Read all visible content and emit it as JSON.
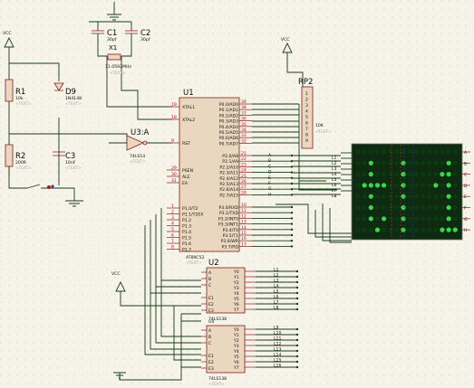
{
  "power": {
    "vcc": "VCC"
  },
  "components": {
    "c1": {
      "ref": "C1",
      "value": "30pf"
    },
    "c2": {
      "ref": "C2",
      "value": "30pf"
    },
    "x1": {
      "ref": "X1",
      "value": "11.0592MHz"
    },
    "r1": {
      "ref": "R1",
      "value": "10k"
    },
    "d9": {
      "ref": "D9",
      "value": "1N4148"
    },
    "r2": {
      "ref": "R2",
      "value": "200R"
    },
    "c3": {
      "ref": "C3",
      "value": "10nF"
    },
    "u3": {
      "ref": "U3:A",
      "value": "74LS14"
    },
    "u1": {
      "ref": "U1",
      "value": "AT89C52"
    },
    "u2": {
      "ref": "U2",
      "value": "74LS138"
    },
    "u4": {
      "ref": "U4",
      "value": "74LS138"
    },
    "rp2": {
      "ref": "RP2",
      "value": "10K"
    },
    "text_tag": "<TEXT>"
  },
  "u1_pins": {
    "left_top": [
      {
        "num": "19",
        "name": "XTAL1"
      },
      {
        "num": "18",
        "name": "XTAL2"
      },
      {
        "num": "9",
        "name": "RST"
      },
      {
        "num": "29",
        "name": "PSEN"
      },
      {
        "num": "30",
        "name": "ALE"
      },
      {
        "num": "31",
        "name": "EA"
      }
    ],
    "left_p1": [
      {
        "num": "1",
        "name": "P1.0/T2"
      },
      {
        "num": "2",
        "name": "P1.1/T2EX"
      },
      {
        "num": "3",
        "name": "P1.2"
      },
      {
        "num": "4",
        "name": "P1.3"
      },
      {
        "num": "5",
        "name": "P1.4"
      },
      {
        "num": "6",
        "name": "P1.5"
      },
      {
        "num": "7",
        "name": "P1.6"
      },
      {
        "num": "8",
        "name": "P1.7"
      }
    ],
    "right_p0": [
      {
        "num": "39",
        "name": "P0.0/AD0"
      },
      {
        "num": "38",
        "name": "P0.1/AD1"
      },
      {
        "num": "37",
        "name": "P0.2/AD2"
      },
      {
        "num": "36",
        "name": "P0.3/AD3"
      },
      {
        "num": "35",
        "name": "P0.4/AD4"
      },
      {
        "num": "34",
        "name": "P0.5/AD5"
      },
      {
        "num": "33",
        "name": "P0.6/AD6"
      },
      {
        "num": "32",
        "name": "P0.7/AD7"
      }
    ],
    "right_p2": [
      {
        "num": "21",
        "name": "P2.0/A8"
      },
      {
        "num": "22",
        "name": "P2.1/A9"
      },
      {
        "num": "23",
        "name": "P2.2/A10"
      },
      {
        "num": "24",
        "name": "P2.3/A11"
      },
      {
        "num": "25",
        "name": "P2.4/A12"
      },
      {
        "num": "26",
        "name": "P2.5/A13"
      },
      {
        "num": "27",
        "name": "P2.6/A14"
      },
      {
        "num": "28",
        "name": "P2.7/A15"
      }
    ],
    "right_p3": [
      {
        "num": "10",
        "name": "P3.0/RXD"
      },
      {
        "num": "11",
        "name": "P3.1/TXD"
      },
      {
        "num": "12",
        "name": "P3.2/INT0"
      },
      {
        "num": "13",
        "name": "P3.3/INT1"
      },
      {
        "num": "14",
        "name": "P3.4/T0"
      },
      {
        "num": "15",
        "name": "P3.5/T1"
      },
      {
        "num": "16",
        "name": "P3.6/WR"
      },
      {
        "num": "17",
        "name": "P3.7/RD"
      }
    ]
  },
  "p2_labels": [
    "A",
    "B",
    "C",
    "D",
    "E",
    "F",
    "G",
    "H"
  ],
  "decoder_inputs": [
    "A",
    "B",
    "C",
    "E1",
    "E2",
    "E3"
  ],
  "decoder_outputs": [
    "Y0",
    "Y1",
    "Y2",
    "Y3",
    "Y4",
    "Y5",
    "Y6",
    "Y7"
  ],
  "u2_lines": [
    "L1",
    "L2",
    "L3",
    "L4",
    "L5",
    "L6",
    "L7",
    "L8"
  ],
  "u4_lines": [
    "L9",
    "L10",
    "L11",
    "L12",
    "L13",
    "L14",
    "L15",
    "L16"
  ],
  "rp2_pins": [
    "1",
    "2",
    "3",
    "4",
    "5",
    "6",
    "7",
    "8",
    "9"
  ],
  "matrix": {
    "row_labels": [
      "A",
      "B",
      "C",
      "D",
      "E",
      "F",
      "G",
      "H"
    ],
    "col_labels": [
      "L1",
      "L2",
      "L3",
      "L4",
      "L5",
      "L6",
      "L7",
      "L8",
      "L9",
      "L10",
      "L11",
      "L12",
      "L13",
      "L14",
      "L15",
      "L16"
    ],
    "lit": [
      "0000000000000000",
      "0010000100000010",
      "0010000100000110",
      "0111100100001010",
      "0010000100000010",
      "0010000100000010",
      "0010100100000010",
      "0001000100000111"
    ],
    "lit_color": "#39d64a",
    "off_color": "#0b3a10"
  },
  "colors": {
    "background": "#f6f4e8",
    "wire": "#173c16",
    "part_outline": "#8b1a1a",
    "part_fill": "#e9d8bf",
    "grid_dot": "#c3bfae",
    "blue_pin": "#2b3fbf",
    "red_pin": "#b41010"
  }
}
